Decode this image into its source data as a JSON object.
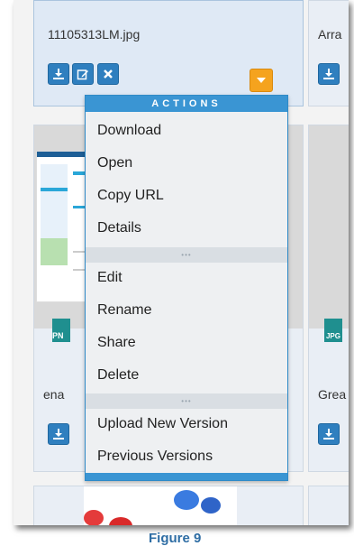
{
  "files": {
    "selected_name": "11105313LM.jpg",
    "right_top_name": "Arra",
    "left_mid_name": "ena",
    "right_mid_name": "Grea",
    "png_badge": "PN",
    "jpg_badge": "JPG"
  },
  "menu": {
    "header": "ACTIONS",
    "group1": [
      "Download",
      "Open",
      "Copy URL",
      "Details"
    ],
    "group2": [
      "Edit",
      "Rename",
      "Share",
      "Delete"
    ],
    "group3": [
      "Upload New Version",
      "Previous Versions"
    ],
    "separator": "•••"
  },
  "caption": "Figure 9",
  "icons": {
    "download": "download-icon",
    "edit": "edit-icon",
    "delete": "close-icon",
    "dropdown": "caret-down-icon"
  },
  "colors": {
    "primary_button": "#2f7fbf",
    "dropdown_button": "#f5a31e",
    "menu_header": "#3a95d3"
  }
}
